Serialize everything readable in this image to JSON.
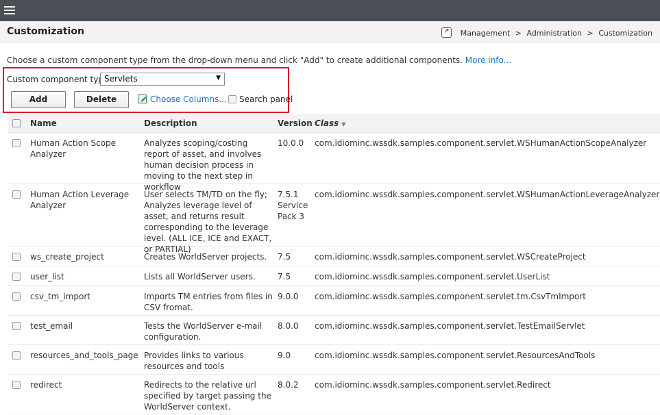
{
  "header": {
    "page_title": "Customization"
  },
  "breadcrumb": {
    "items": [
      "Management",
      "Administration",
      "Customization"
    ],
    "separator": ">"
  },
  "intro": {
    "text": "Choose a custom component type from the drop-down menu and click \"Add\" to create additional components.",
    "more_link": "More info..."
  },
  "controls": {
    "type_label": "Custom component type:",
    "type_value": "Servlets",
    "add_label": "Add",
    "delete_label": "Delete",
    "choose_columns_label": "Choose Columns...",
    "search_panel_label": "Search panel"
  },
  "table": {
    "columns": {
      "name": "Name",
      "description": "Description",
      "version": "Version",
      "class": "Class"
    },
    "rows": [
      {
        "name": "Human Action Scope Analyzer",
        "description": "Analyzes scoping/costing report of asset, and involves human decision process in moving to the next step in workflow",
        "version": "10.0.0",
        "class": "com.idiominc.wssdk.samples.component.servlet.WSHumanActionScopeAnalyzer"
      },
      {
        "name": "Human Action Leverage Analyzer",
        "description": "User selects TM/TD on the fly; Analyzes leverage level of asset, and returns result corresponding to the leverage level. (ALL ICE, ICE and EXACT, or PARTIAL)",
        "version": "7.5.1 Service Pack 3",
        "class": "com.idiominc.wssdk.samples.component.servlet.WSHumanActionLeverageAnalyzer"
      },
      {
        "name": "ws_create_project",
        "description": "Creates WorldServer projects.",
        "version": "7.5",
        "class": "com.idiominc.wssdk.samples.component.servlet.WSCreateProject"
      },
      {
        "name": "user_list",
        "description": "Lists all WorldServer users.",
        "version": "7.5",
        "class": "com.idiominc.wssdk.samples.component.servlet.UserList"
      },
      {
        "name": "csv_tm_import",
        "description": "Imports TM entries from files in CSV fromat.",
        "version": "9.0.0",
        "class": "com.idiominc.wssdk.samples.component.servlet.tm.CsvTmImport"
      },
      {
        "name": "test_email",
        "description": "Tests the WorldServer e-mail configuration.",
        "version": "8.0.0",
        "class": "com.idiominc.wssdk.samples.component.servlet.TestEmailServlet"
      },
      {
        "name": "resources_and_tools_page",
        "description": "Provides links to various resources and tools",
        "version": "9.0",
        "class": "com.idiominc.wssdk.samples.component.servlet.ResourcesAndTools"
      },
      {
        "name": "redirect",
        "description": "Redirects to the relative url specified by target passing the WorldServer context.",
        "version": "8.0.2",
        "class": "com.idiominc.wssdk.samples.component.servlet.Redirect"
      }
    ]
  },
  "colors": {
    "topbar": "#4a4e55",
    "link": "#1f6fc5",
    "highlight": "#d0202d"
  },
  "icons": {
    "menu": "hamburger-menu-icon",
    "breadcrumb": "external-link-icon",
    "choose_columns": "edit-columns-icon",
    "sort": "sort-down-icon"
  }
}
